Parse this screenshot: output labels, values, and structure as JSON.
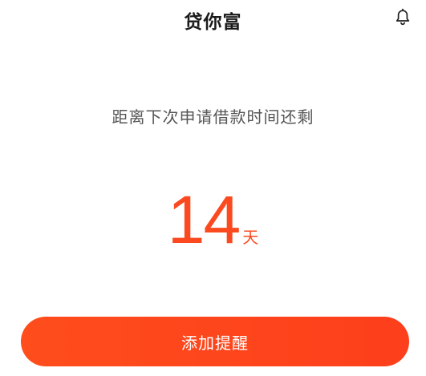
{
  "header": {
    "title": "贷你富",
    "notification_icon": "bell-icon"
  },
  "main": {
    "subtitle": "距离下次申请借款时间还剩",
    "countdown_value": "14",
    "countdown_unit": "天"
  },
  "actions": {
    "reminder_button_label": "添加提醒"
  },
  "colors": {
    "accent": "#fb4a1f",
    "title": "#1a1a1a",
    "subtitle": "#555555",
    "background": "#ffffff"
  }
}
